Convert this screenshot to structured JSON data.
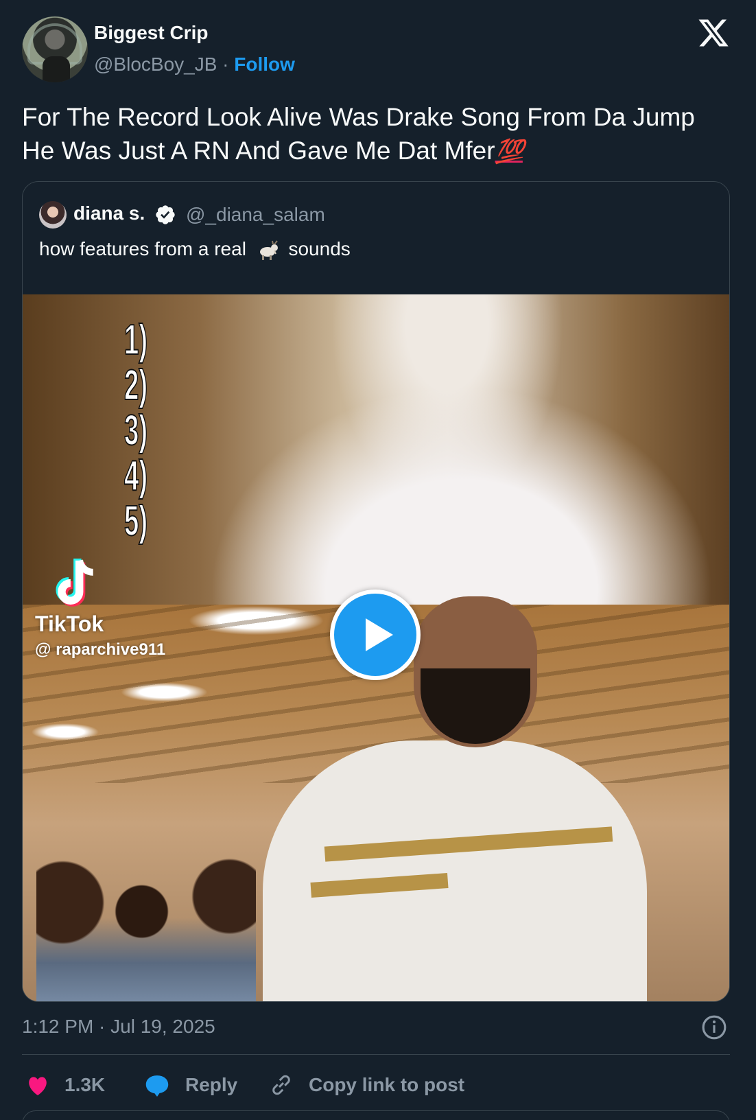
{
  "author": {
    "display_name": "Biggest Crip",
    "handle": "@BlocBoy_JB",
    "separator": "·",
    "follow_label": "Follow"
  },
  "tweet": {
    "text_line1": "For The Record Look Alive Was Drake Song From Da Jump",
    "text_line2": "He Was Just A RN And Gave Me Dat Mfer",
    "emoji_hundred": "💯"
  },
  "quoted_tweet": {
    "display_name": "diana s.",
    "handle": "@_diana_salam",
    "text_before": "how features from a real",
    "text_after": "sounds",
    "emoji_icon": "goat-icon"
  },
  "video": {
    "list_numbers": [
      "1)",
      "2)",
      "3)",
      "4)",
      "5)"
    ],
    "watermark_label": "TikTok",
    "watermark_handle": "@ raparchive911"
  },
  "footer": {
    "timestamp": "1:12 PM · Jul 19, 2025",
    "like_count": "1.3K",
    "reply_label": "Reply",
    "copy_link_label": "Copy link to post"
  },
  "colors": {
    "background": "#15202b",
    "accent": "#1d9bf0",
    "muted_text": "#8b98a5",
    "like_pink": "#f91880",
    "border": "#38444d"
  }
}
